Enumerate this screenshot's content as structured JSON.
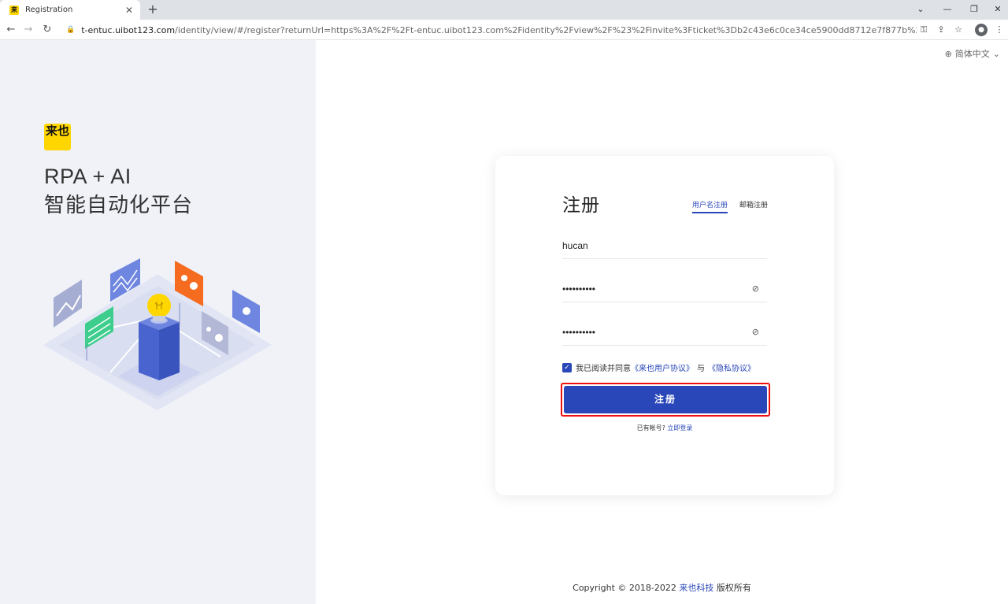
{
  "browser": {
    "tab_title": "Registration",
    "favicon_text": "来",
    "url_host": "t-entuc.uibot123.com",
    "url_path": "/identity/view/#/register?returnUrl=https%3A%2F%2Ft-entuc.uibot123.com%2Fidentity%2Fview%2F%23%2Finvite%3Fticket%3Db2c43e6c0ce34ce5900dd8712e7f877b%26type%3DcommanderAd..."
  },
  "hero": {
    "logo_text": "来也",
    "line1": "RPA + AI",
    "line2": "智能自动化平台"
  },
  "lang": {
    "label": "简体中文"
  },
  "form": {
    "title": "注册",
    "tab_username": "用户名注册",
    "tab_email": "邮箱注册",
    "username_value": "hucan",
    "password_value": "••••••••••",
    "confirm_value": "••••••••••",
    "agree_text": "我已阅读并同意",
    "agree_link1": "《来也用户协议》",
    "agree_sep": "与",
    "agree_link2": "《隐私协议》",
    "register_label": "注册",
    "have_account": "已有帐号?",
    "login_link": "立即登录"
  },
  "footer": {
    "copyright": "Copyright © 2018-2022",
    "company": "来也科技",
    "rights": "版权所有"
  },
  "colors": {
    "accent": "#2947b8",
    "highlight": "#e11111",
    "logo": "#ffd600"
  }
}
